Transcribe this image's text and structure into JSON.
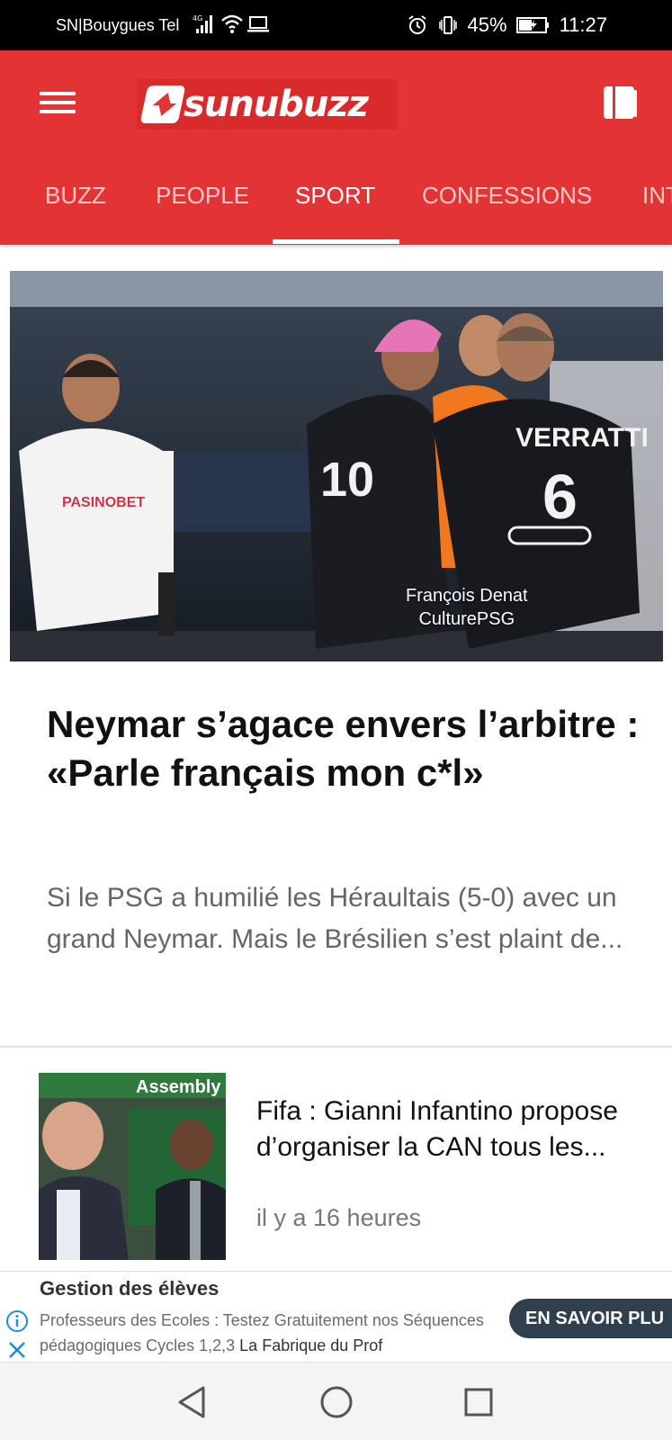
{
  "status_bar": {
    "carrier": "SN|Bouygues Tel",
    "battery": "45%",
    "time": "11:27"
  },
  "header": {
    "logo_text": "sunubuzz",
    "brand_color": "#e23335"
  },
  "tabs": [
    {
      "label": "BUZZ",
      "active": false
    },
    {
      "label": "PEOPLE",
      "active": false
    },
    {
      "label": "SPORT",
      "active": true
    },
    {
      "label": "CONFESSIONS",
      "active": false
    },
    {
      "label": "INT",
      "active": false
    }
  ],
  "featured": {
    "image_credit_line1": "François Denat",
    "image_credit_line2": "CulturePSG",
    "jersey_name": "VERRATTI",
    "jersey_number": "6",
    "sponsor": "PASINOBET",
    "headline": "Neymar s’agace envers l’arbitre : «Parle français mon c*l»",
    "excerpt": "Si le PSG a humilié les Héraultais (5-0) avec un grand Neymar. Mais le Brésilien s’est plaint de..."
  },
  "articles": [
    {
      "title": "Fifa : Gianni Infantino propose d’organiser la CAN tous les...",
      "time": "il y a 16 heures",
      "thumb_banner_text": "Assembly"
    }
  ],
  "ad": {
    "title": "Gestion des élèves",
    "body": "Professeurs des Ecoles : Testez Gratuitement nos Séquences pédagogiques Cycles 1,2,3",
    "advertiser": "La Fabrique du Prof",
    "cta": "EN SAVOIR PLU"
  }
}
